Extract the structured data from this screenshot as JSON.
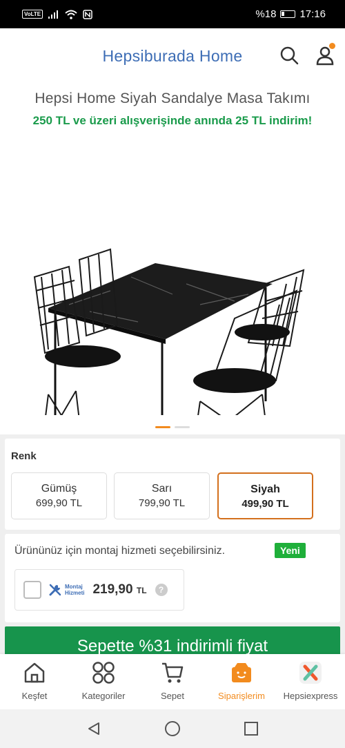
{
  "status_bar": {
    "volte": "VoLTE",
    "battery": "%18",
    "time": "17:16"
  },
  "header": {
    "title": "Hepsiburada Home",
    "search_icon": "search-icon",
    "account_icon": "user-icon"
  },
  "product": {
    "title": "Hepsi Home Siyah Sandalye Masa Takımı",
    "promo": "250 TL ve üzeri alışverişinde anında 25 TL indirim!",
    "image_count": 2,
    "active_image": 1
  },
  "color_selector": {
    "label": "Renk",
    "options": [
      {
        "name": "Gümüş",
        "price": "699,90 TL",
        "selected": false
      },
      {
        "name": "Sarı",
        "price": "799,90 TL",
        "selected": false
      },
      {
        "name": "Siyah",
        "price": "499,90 TL",
        "selected": true
      }
    ]
  },
  "assembly": {
    "text": "Ürününüz için montaj hizmeti seçebilirsiniz.",
    "badge": "Yeni",
    "service_label_line1": "Montaj",
    "service_label_line2": "Hizmeti",
    "price": "219,90",
    "currency": "TL",
    "help": "?"
  },
  "cta": {
    "label": "Sepette %31 indirimli fiyat"
  },
  "tabs": [
    {
      "label": "Keşfet",
      "icon": "home-icon",
      "active": false
    },
    {
      "label": "Kategoriler",
      "icon": "grid-icon",
      "active": false
    },
    {
      "label": "Sepet",
      "icon": "cart-icon",
      "active": false
    },
    {
      "label": "Siparişlerim",
      "icon": "orders-box-icon",
      "active": true
    },
    {
      "label": "Hepsiexpress",
      "icon": "hepsiexpress-icon",
      "active": false
    }
  ],
  "colors": {
    "brand_blue": "#3d6db5",
    "accent_orange": "#f28b1e",
    "promo_green": "#1a9b4b",
    "cta_green": "#17944c",
    "badge_green": "#1faf3a"
  }
}
